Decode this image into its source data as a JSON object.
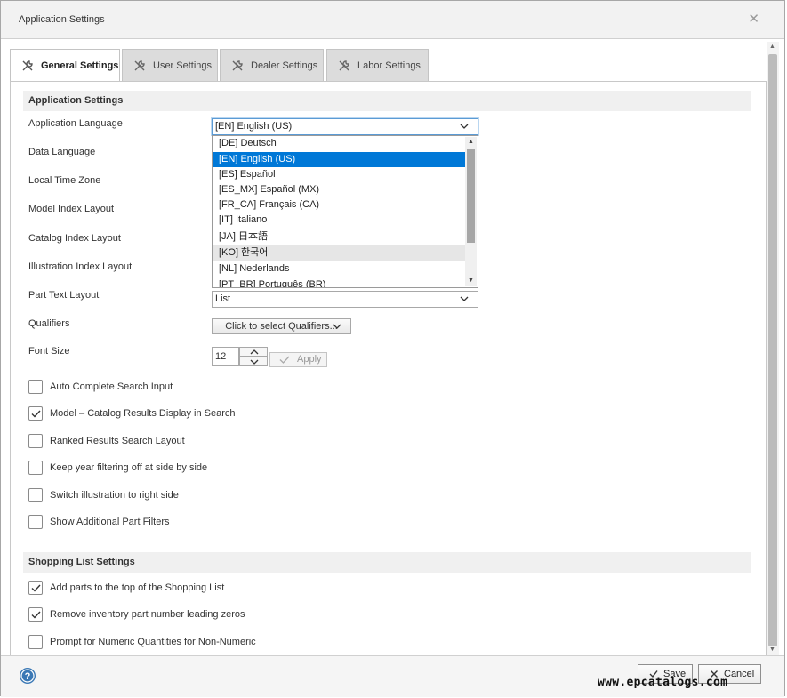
{
  "window": {
    "title": "Application Settings",
    "close_glyph": "✕"
  },
  "tabs": [
    {
      "label": "General Settings",
      "icon": "tools-icon",
      "active": true
    },
    {
      "label": "User Settings",
      "icon": "tools-icon"
    },
    {
      "label": "Dealer Settings",
      "icon": "tools-icon"
    },
    {
      "label": "Labor Settings",
      "icon": "tools-icon"
    }
  ],
  "app_settings": {
    "heading": "Application Settings",
    "rows": [
      {
        "label": "Application Language",
        "value": "[EN] English (US)"
      },
      {
        "label": "Data Language"
      },
      {
        "label": "Local Time Zone"
      },
      {
        "label": "Model Index Layout"
      },
      {
        "label": "Catalog Index Layout"
      },
      {
        "label": "Illustration Index Layout"
      },
      {
        "label": "Part Text Layout",
        "value": "List"
      },
      {
        "label": "Qualifiers",
        "button": "Click to select Qualifiers..."
      },
      {
        "label": "Font Size",
        "value": "12",
        "apply": "Apply"
      }
    ],
    "language_options": [
      "[DE] Deutsch",
      "[EN] English (US)",
      "[ES] Español",
      "[ES_MX] Español (MX)",
      "[FR_CA] Français (CA)",
      "[IT] Italiano",
      "[JA] 日本語",
      "[KO] 한국어",
      "[NL] Nederlands",
      "[PT_BR] Português (BR)"
    ],
    "checkboxes": [
      {
        "label": "Auto Complete Search Input",
        "checked": false
      },
      {
        "label": "Model – Catalog Results Display in Search",
        "checked": true
      },
      {
        "label": "Ranked Results Search Layout",
        "checked": false
      },
      {
        "label": "Keep year filtering off at side by side",
        "checked": false
      },
      {
        "label": "Switch illustration to right side",
        "checked": false
      },
      {
        "label": "Show Additional Part Filters",
        "checked": false
      }
    ]
  },
  "shopping": {
    "heading": "Shopping List Settings",
    "checkboxes": [
      {
        "label": "Add parts to the top of the Shopping List",
        "checked": true
      },
      {
        "label": "Remove inventory part number leading zeros",
        "checked": true
      },
      {
        "label": "Prompt for Numeric Quantities for Non-Numeric",
        "checked": false
      }
    ]
  },
  "footer": {
    "save": "Save",
    "cancel": "Cancel",
    "help_glyph": "?"
  },
  "watermark": "www.epcatalogs.com",
  "colors": {
    "accent": "#0078d7",
    "help": "#3a78b5"
  }
}
